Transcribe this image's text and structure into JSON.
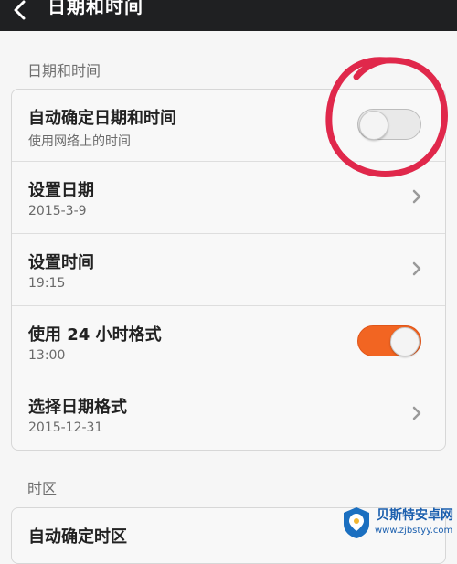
{
  "header": {
    "title": "日期和时间",
    "back_icon": "chevron-left-icon"
  },
  "section1": {
    "label": "日期和时间",
    "rows": [
      {
        "title": "自动确定日期和时间",
        "subtitle": "使用网络上的时间",
        "control": "toggle",
        "enabled": false
      },
      {
        "title": "设置日期",
        "subtitle": "2015-3-9",
        "control": "chevron"
      },
      {
        "title": "设置时间",
        "subtitle": "19:15",
        "control": "chevron"
      },
      {
        "title": "使用 24 小时格式",
        "subtitle": "13:00",
        "control": "toggle",
        "enabled": true
      },
      {
        "title": "选择日期格式",
        "subtitle": "2015-12-31",
        "control": "chevron"
      }
    ]
  },
  "section2": {
    "label": "时区",
    "rows": [
      {
        "title": "自动确定时区"
      }
    ]
  },
  "watermark": {
    "name": "贝斯特安卓网",
    "url": "www.zjbstyy.com"
  },
  "colors": {
    "accent": "#f26522",
    "annotation": "#e0284b",
    "topbar": "#1f2022"
  }
}
